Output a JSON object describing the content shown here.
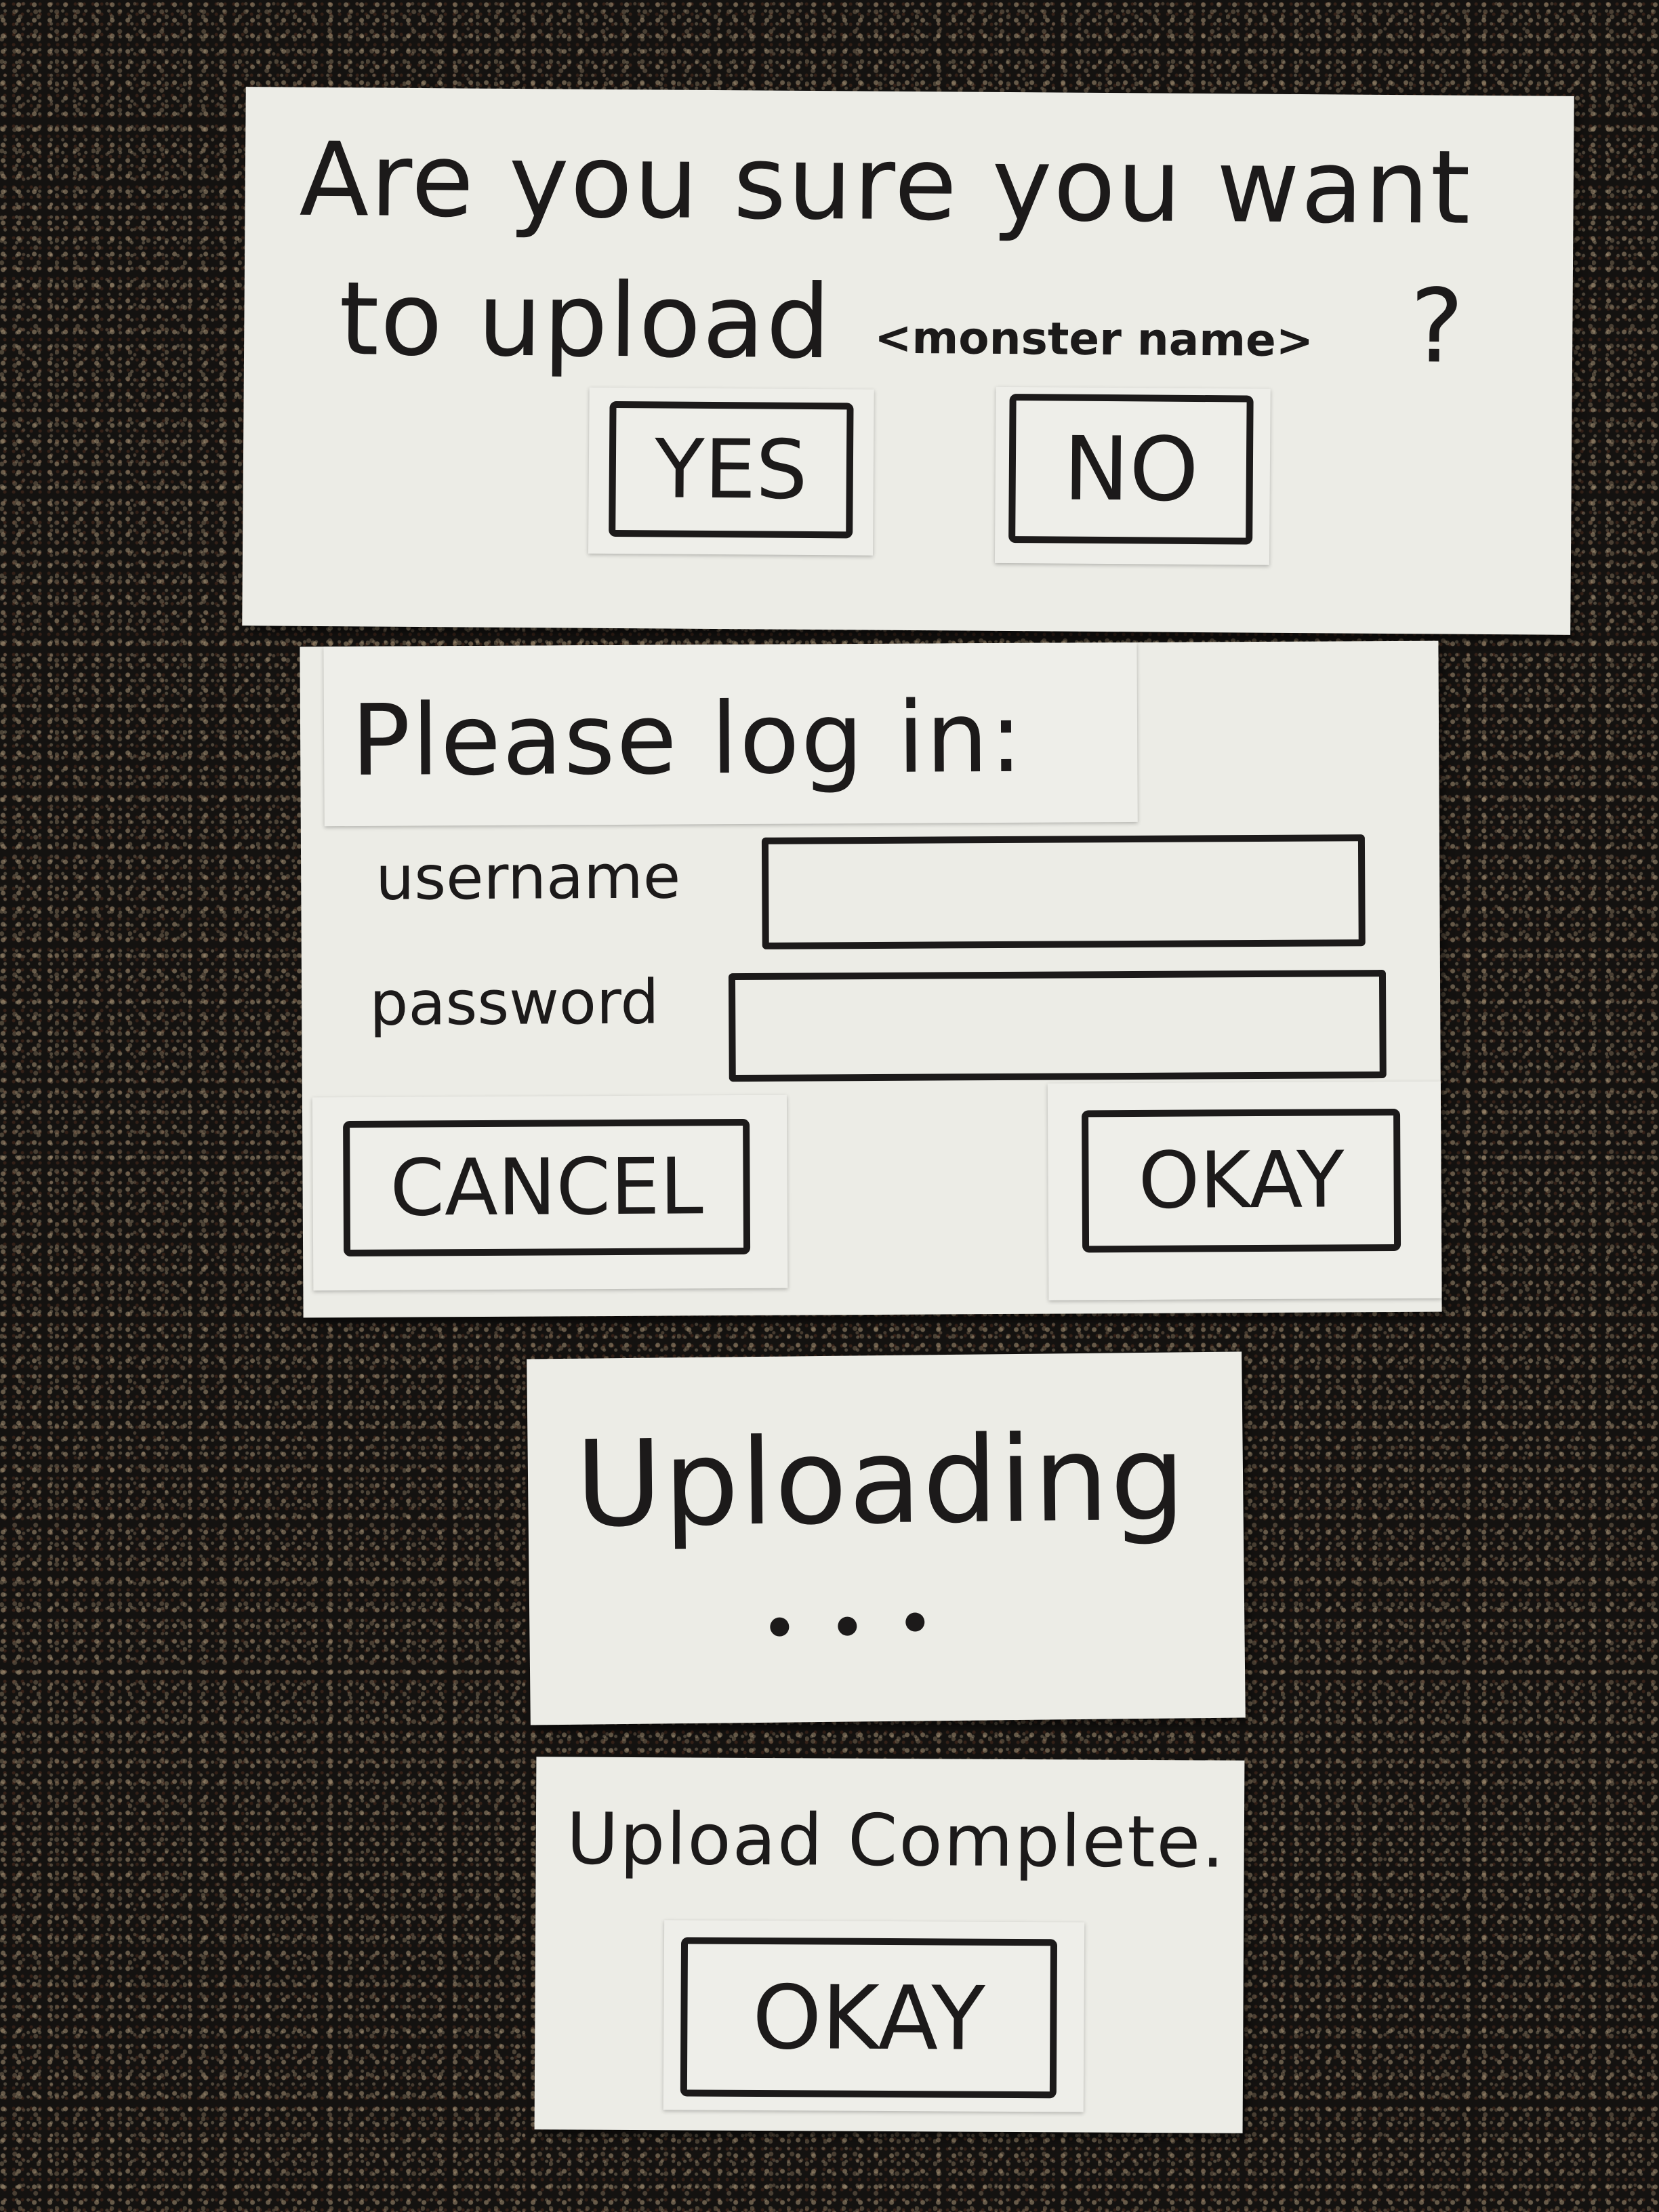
{
  "confirm_dialog": {
    "question_line1": "Are you sure you want",
    "question_line2": "to upload",
    "placeholder": "<monster name>",
    "question_mark": "?",
    "yes_label": "YES",
    "no_label": "NO"
  },
  "login_dialog": {
    "title": "Please log in:",
    "username_label": "username",
    "password_label": "password",
    "username_value": "",
    "password_value": "",
    "cancel_label": "CANCEL",
    "okay_label": "OKAY"
  },
  "uploading_dialog": {
    "text": "Uploading"
  },
  "complete_dialog": {
    "text": "Upload Complete.",
    "okay_label": "OKAY"
  }
}
